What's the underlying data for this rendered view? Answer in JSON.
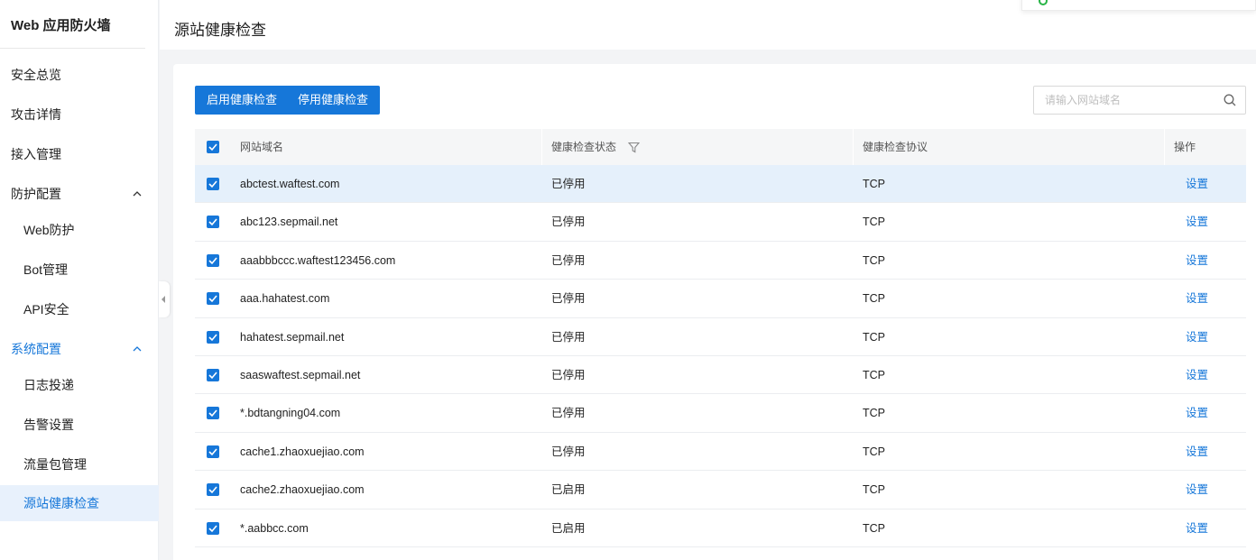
{
  "app": {
    "title": "Web 应用防火墙"
  },
  "sidebar": {
    "items": [
      {
        "label": "安全总览"
      },
      {
        "label": "攻击详情"
      },
      {
        "label": "接入管理"
      },
      {
        "label": "防护配置"
      },
      {
        "label": "Web防护"
      },
      {
        "label": "Bot管理"
      },
      {
        "label": "API安全"
      },
      {
        "label": "系统配置"
      },
      {
        "label": "日志投递"
      },
      {
        "label": "告警设置"
      },
      {
        "label": "流量包管理"
      },
      {
        "label": "源站健康检查"
      }
    ]
  },
  "header": {
    "title": "源站健康检查"
  },
  "toolbar": {
    "enable_label": "启用健康检查",
    "disable_label": "停用健康检查"
  },
  "search": {
    "placeholder": "请输入网站域名"
  },
  "table": {
    "columns": [
      "网站域名",
      "健康检查状态",
      "健康检查协议",
      "操作"
    ],
    "rows": [
      {
        "domain": "abctest.waftest.com",
        "status": "已停用",
        "protocol": "TCP",
        "action": "设置"
      },
      {
        "domain": "abc123.sepmail.net",
        "status": "已停用",
        "protocol": "TCP",
        "action": "设置"
      },
      {
        "domain": "aaabbbccc.waftest123456.com",
        "status": "已停用",
        "protocol": "TCP",
        "action": "设置"
      },
      {
        "domain": "aaa.hahatest.com",
        "status": "已停用",
        "protocol": "TCP",
        "action": "设置"
      },
      {
        "domain": "hahatest.sepmail.net",
        "status": "已停用",
        "protocol": "TCP",
        "action": "设置"
      },
      {
        "domain": "saaswaftest.sepmail.net",
        "status": "已停用",
        "protocol": "TCP",
        "action": "设置"
      },
      {
        "domain": "*.bdtangning04.com",
        "status": "已停用",
        "protocol": "TCP",
        "action": "设置"
      },
      {
        "domain": "cache1.zhaoxuejiao.com",
        "status": "已停用",
        "protocol": "TCP",
        "action": "设置"
      },
      {
        "domain": "cache2.zhaoxuejiao.com",
        "status": "已启用",
        "protocol": "TCP",
        "action": "设置"
      },
      {
        "domain": "*.aabbcc.com",
        "status": "已启用",
        "protocol": "TCP",
        "action": "设置"
      }
    ]
  },
  "colors": {
    "accent": "#1677d9",
    "active_bg": "#e8f1fc",
    "row_highlight": "#e5f0fb"
  }
}
